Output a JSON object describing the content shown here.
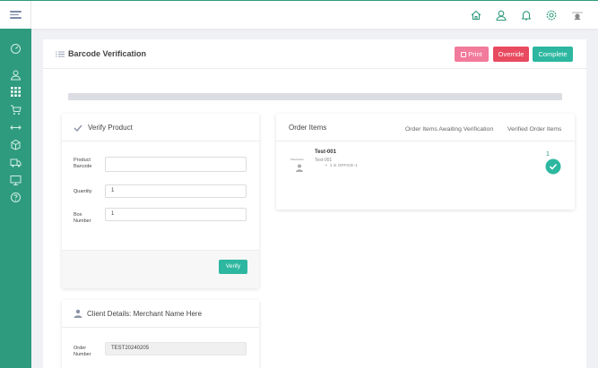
{
  "icons": {
    "menu": "hamburger-menu-icon",
    "top": [
      "home-icon",
      "user-icon",
      "bell-icon",
      "settings-gear-icon",
      "avatar-icon"
    ],
    "sidebar": [
      "dashboard-gauge-icon",
      "user-icon",
      "apps-grid-icon",
      "cart-icon",
      "transfer-arrows-icon",
      "box-icon",
      "truck-icon",
      "monitor-icon",
      "help-icon"
    ]
  },
  "colors": {
    "accent": "#2f9b7e",
    "teal_button": "#2db7a0",
    "print_button": "#f27a9b",
    "override_button": "#e84a5f"
  },
  "page": {
    "title": "Barcode Verification",
    "buttons": {
      "print": "Print",
      "override": "Override",
      "complete": "Complete"
    },
    "progress": 0
  },
  "verify": {
    "title": "Verify Product",
    "fields": {
      "barcode_label_1": "Product",
      "barcode_label_2": "Barcode",
      "barcode_value": "",
      "quantity_label": "Quantity",
      "quantity_value": "1",
      "box_label_1": "Box",
      "box_label_2": "Number",
      "box_value": "1"
    },
    "verify_button": "Verify"
  },
  "order_items": {
    "title": "Order Items",
    "tabs": {
      "awaiting": "Order Items Awaiting Verification",
      "verified": "Verified Order Items"
    },
    "items": [
      {
        "thumb_label": "Placeholder",
        "name": "Test-001",
        "sku": "Test-001",
        "location": "1 in OFFICE-1",
        "quantity": "1",
        "status_icon": "check-circle-icon"
      }
    ]
  },
  "client": {
    "title": "Client Details: Merchant Name Here",
    "order_label_1": "Order",
    "order_label_2": "Number",
    "order_number": "TEST20240205"
  }
}
